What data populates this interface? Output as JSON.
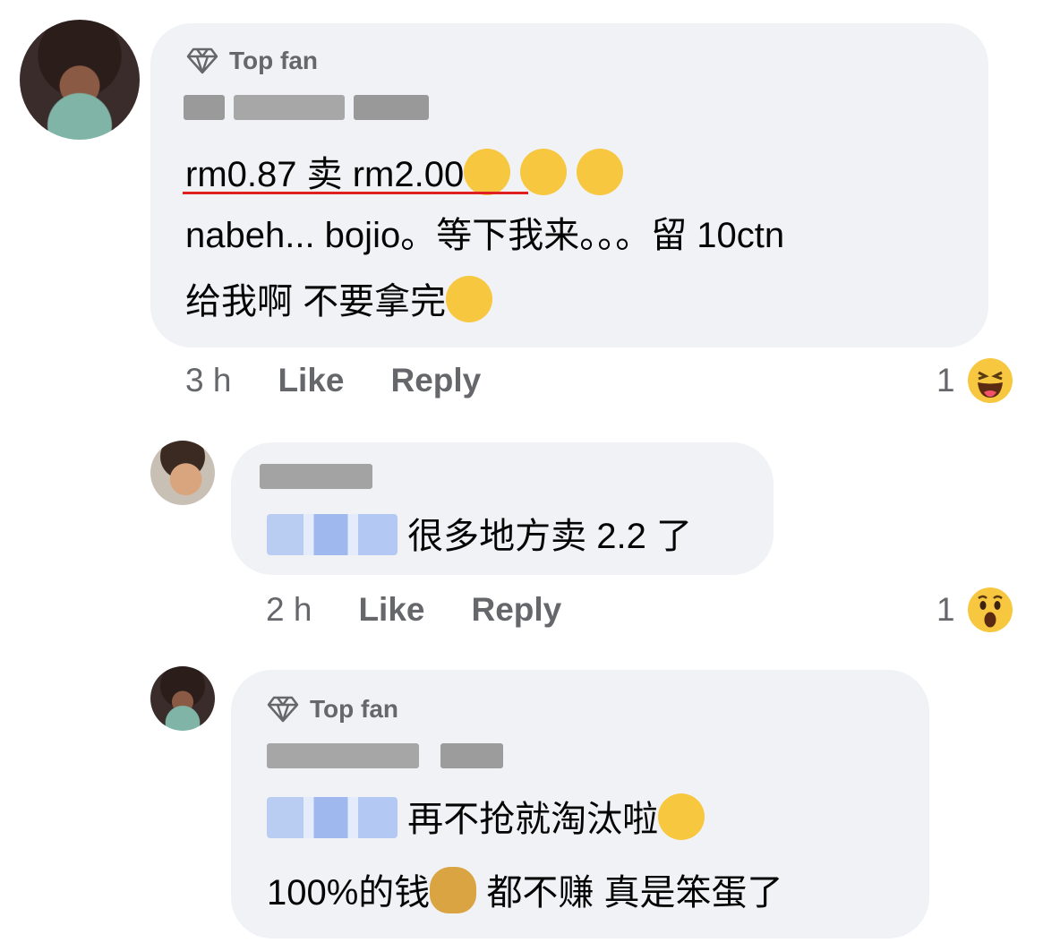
{
  "comments": [
    {
      "badge": "Top fan",
      "line1": "rm0.87 卖 rm2.00",
      "line2": "nabeh... bojio。等下我来。。。留 10ctn",
      "line3": "给我啊 不要拿完",
      "time": "3 h",
      "like": "Like",
      "reply": "Reply",
      "reaction_count": "1",
      "reaction_icon": "haha-reaction-icon"
    },
    {
      "text": "很多地方卖 2.2 了",
      "time": "2 h",
      "like": "Like",
      "reply": "Reply",
      "reaction_count": "1",
      "reaction_icon": "wow-reaction-icon"
    },
    {
      "badge": "Top fan",
      "line1": "再不抢就淘汰啦",
      "line2_a": "100%的钱",
      "line2_b": "都不赚 真是笨蛋了"
    }
  ],
  "colors": {
    "bubble": "#f0f2f5",
    "meta": "#65676b",
    "mention": "#b9cdf2",
    "emoji": "#f7c740",
    "underline": "#e02020"
  }
}
